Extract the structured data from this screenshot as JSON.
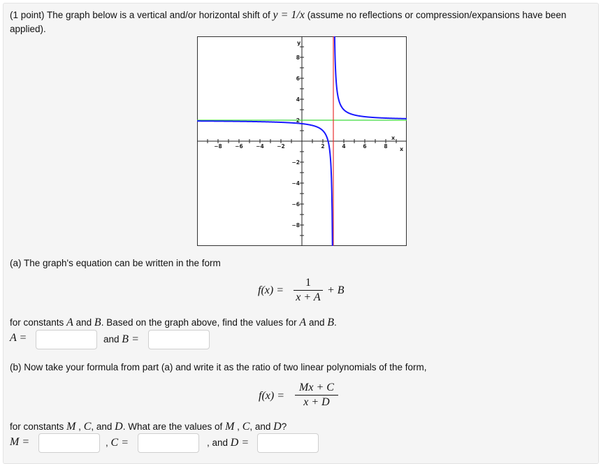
{
  "problem": {
    "intro_prefix": "(1 point) The graph below is a vertical and/or horizontal shift of",
    "intro_math": "y = 1/x",
    "intro_suffix": "(assume no reflections or compression/expansions have been",
    "intro_line2": "applied)."
  },
  "part_a": {
    "prompt": "(a) The graph's equation can be written in the form",
    "formula_lhs": "f(x) =",
    "formula_num": "1",
    "formula_den": "x + A",
    "formula_tail": "+ B",
    "constants_text_1": "for constants",
    "var_A": "A",
    "and_1": "and",
    "var_B": "B",
    "constants_text_2": ". Based on the graph above, find the values for",
    "var_A2": "A",
    "and_2": "and",
    "var_B2": "B",
    "period": ".",
    "label_A": "A =",
    "label_and_B_text": "and",
    "label_B": "B =",
    "input_A_value": "",
    "input_B_value": ""
  },
  "part_b": {
    "prompt": "(b) Now take your formula from part (a) and write it as the ratio of two linear polynomials of the form,",
    "formula_lhs": "f(x) =",
    "formula_num": "Mx + C",
    "formula_den": "x + D",
    "constants_text_1": "for constants",
    "var_M": "M",
    "comma1": ",",
    "var_C": "C",
    "comma2": ", and",
    "var_D": "D",
    "constants_text_2": ". What are the values of",
    "var_M2": "M",
    "comma3": ",",
    "var_C2": "C",
    "comma4": ", and",
    "var_D2": "D",
    "qmark": "?",
    "label_M": "M =",
    "label_C_prefix": ",",
    "label_C": "C =",
    "label_D_prefix": ", and",
    "label_D": "D =",
    "input_M_value": "",
    "input_C_value": "",
    "input_D_value": ""
  },
  "chart_data": {
    "type": "line",
    "title": "",
    "xlabel": "x",
    "ylabel": "y",
    "xlim": [
      -10,
      10
    ],
    "ylim": [
      -10,
      10
    ],
    "x_tick_labels": [
      "-8",
      "-6",
      "-4",
      "-2",
      "2",
      "4",
      "6",
      "8"
    ],
    "y_tick_labels": [
      "8",
      "6",
      "4",
      "2",
      "-2",
      "-4",
      "-6",
      "-8"
    ],
    "grid": false,
    "series": [
      {
        "name": "f(x) = 1/(x-3) + 2",
        "kind": "function",
        "h_shift": 3,
        "v_shift": 2,
        "color": "#1a1aff"
      },
      {
        "name": "horizontal asymptote y = 2",
        "kind": "hline",
        "y": 2,
        "color": "#3ddc3d"
      },
      {
        "name": "vertical asymptote x = 3",
        "kind": "vline",
        "x": 3,
        "color": "#e83030"
      }
    ]
  }
}
